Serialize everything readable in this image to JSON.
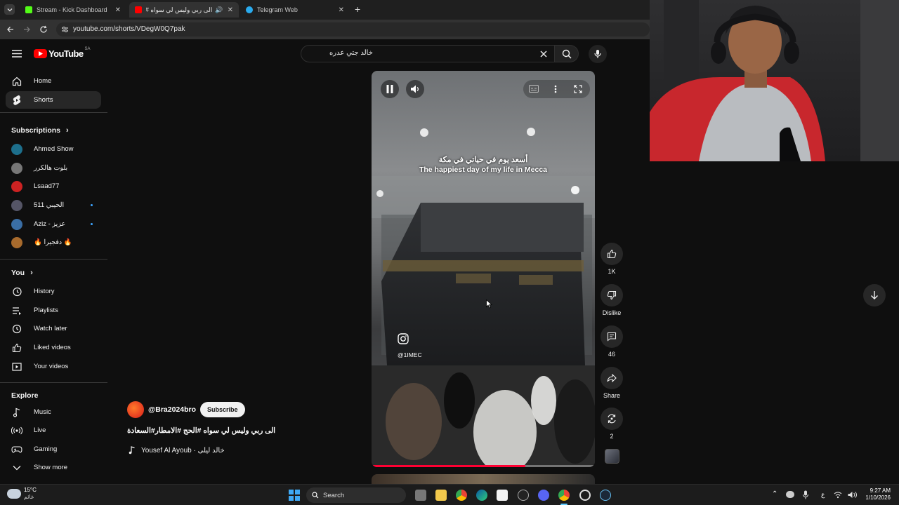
{
  "browser": {
    "tabs": [
      {
        "title": "Stream - Kick Dashboard",
        "icon": "kick-icon",
        "color": "#53fc18"
      },
      {
        "title": "الى ربي وليس لي سواه #الح",
        "icon": "youtube-icon",
        "color": "#ff0000"
      },
      {
        "title": "Telegram Web",
        "icon": "telegram-icon",
        "color": "#2aabee"
      }
    ],
    "url": "youtube.com/shorts/VDegW0Q7pak"
  },
  "youtube": {
    "logo_text": "YouTube",
    "region": "SA",
    "search_value": "خالد جتي عدره",
    "nav": [
      {
        "label": "Home",
        "icon": "home-icon"
      },
      {
        "label": "Shorts",
        "icon": "shorts-icon"
      }
    ],
    "subscriptions_title": "Subscriptions",
    "subscriptions": [
      {
        "label": "Ahmed Show",
        "color": "#1d6f8c",
        "new": false
      },
      {
        "label": "بلوت هالكرر",
        "color": "#777",
        "new": false
      },
      {
        "label": "Lsaad77",
        "color": "#c22",
        "new": false
      },
      {
        "label": "الحيبي 511",
        "color": "#556",
        "new": true
      },
      {
        "label": "Aziz - عزيز",
        "color": "#3a6ea5",
        "new": true
      },
      {
        "label": "🔥 دفجيرا 🔥",
        "color": "#a86b2d",
        "new": false
      }
    ],
    "you_title": "You",
    "you": [
      {
        "label": "History",
        "icon": "history-icon"
      },
      {
        "label": "Playlists",
        "icon": "playlists-icon"
      },
      {
        "label": "Watch later",
        "icon": "clock-icon"
      },
      {
        "label": "Liked videos",
        "icon": "thumbs-up-icon"
      },
      {
        "label": "Your videos",
        "icon": "play-square-icon"
      }
    ],
    "explore_title": "Explore",
    "explore": [
      {
        "label": "Music",
        "icon": "music-note-icon"
      },
      {
        "label": "Live",
        "icon": "live-icon"
      },
      {
        "label": "Gaming",
        "icon": "gamepad-icon"
      },
      {
        "label": "Show more",
        "icon": "chevron-down-icon"
      }
    ]
  },
  "short": {
    "overlay_ar": "أسعد يوم في حياتي في مكة",
    "overlay_en": "The happiest day of my life in Mecca",
    "watermark": "@1IMEC",
    "channel": "@Bra2024bro",
    "subscribe_label": "Subscribe",
    "title": "الى ربي وليس لي سواه #الحج #الامطار#السعادة",
    "sound": "Yousef Al Ayoub · خالد ليلى",
    "progress": 0.69,
    "likes": "1K",
    "dislike_label": "Dislike",
    "comments": "46",
    "share_label": "Share",
    "remix": "2"
  },
  "taskbar": {
    "weather_temp": "15°C",
    "weather_desc": "غائم",
    "search_label": "Search",
    "lang": "ع",
    "time": "9:27 AM",
    "date": "1/10/2026"
  }
}
